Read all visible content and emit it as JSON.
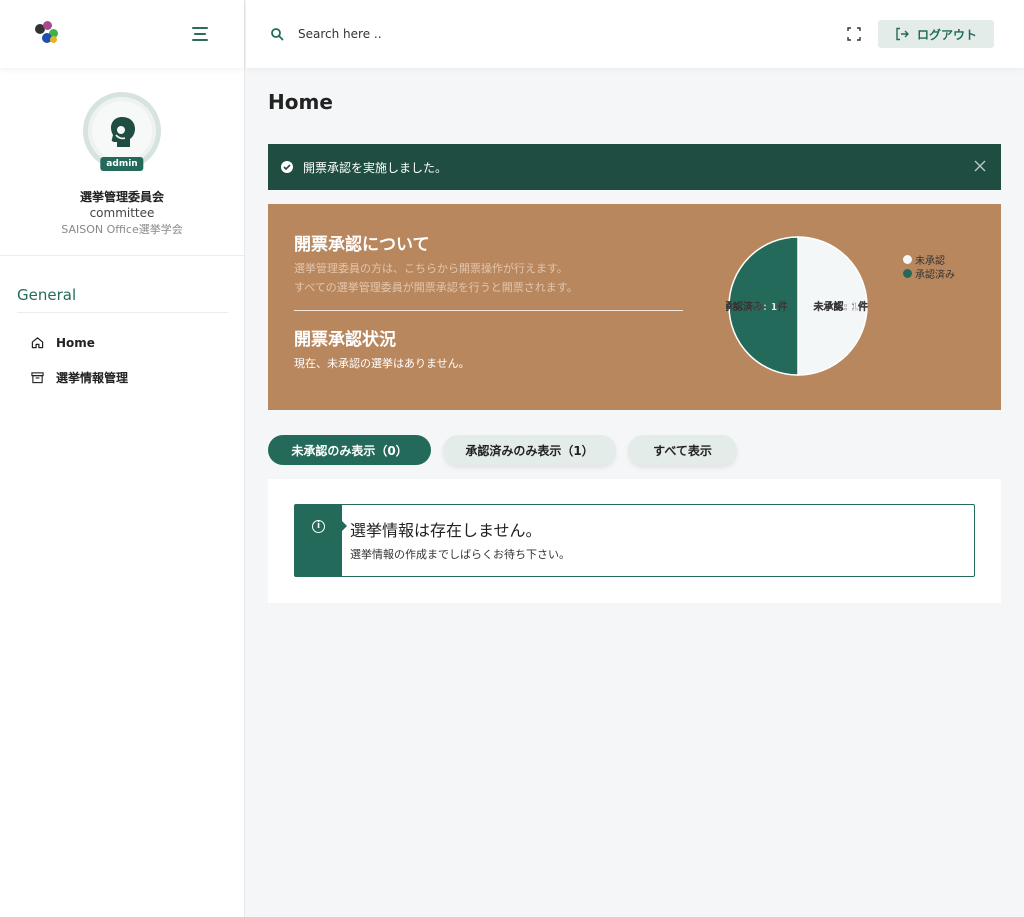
{
  "header": {
    "search_placeholder": "Search here ..",
    "logout_label": "ログアウト"
  },
  "sidebar": {
    "profile": {
      "badge": "admin",
      "name": "選挙管理委員会",
      "role": "committee",
      "org": "SAISON Office選挙学会"
    },
    "section_title": "General",
    "items": [
      {
        "label": "Home",
        "icon": "home-icon"
      },
      {
        "label": "選挙情報管理",
        "icon": "archive-icon"
      }
    ]
  },
  "page": {
    "title": "Home"
  },
  "alert": {
    "message": "開票承認を実施しました。"
  },
  "banner": {
    "heading1": "開票承認について",
    "desc1": "選挙管理委員の方は、こちらから開票操作が行えます。",
    "desc2": "すべての選挙管理委員が開票承認を行うと開票されます。",
    "heading2": "開票承認状況",
    "status": "現在、未承認の選挙はありません。"
  },
  "chart_data": {
    "type": "pie",
    "labels": [
      "未承認",
      "承認済み"
    ],
    "values": [
      1,
      1
    ],
    "slice_labels": [
      "未承認: 1件",
      "承認済み: 1件"
    ],
    "colors": [
      "#f4f7f8",
      "#246a5a"
    ],
    "legend_position": "top-right"
  },
  "filters": [
    {
      "label": "未承認のみ表示（0）",
      "active": true
    },
    {
      "label": "承認済みのみ表示（1）",
      "active": false
    },
    {
      "label": "すべて表示",
      "active": false
    }
  ],
  "notice": {
    "title": "選挙情報は存在しません。",
    "message": "選挙情報の作成までしばらくお待ち下さい。"
  }
}
